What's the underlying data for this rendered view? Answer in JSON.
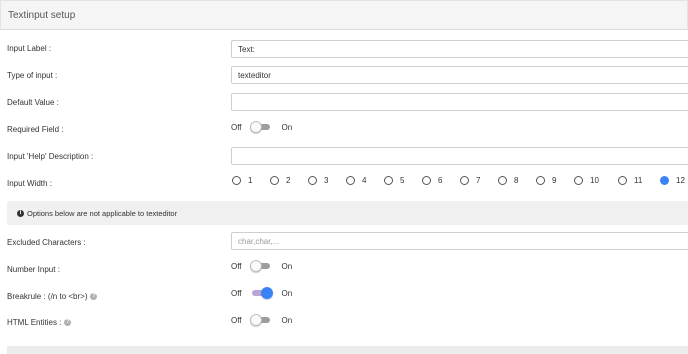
{
  "header": {
    "title": "Textinput setup"
  },
  "fields": {
    "input_label": {
      "label": "Input Label :",
      "value": "Text:"
    },
    "type_of_input": {
      "label": "Type of input :",
      "value": "texteditor"
    },
    "default_value": {
      "label": "Default Value :",
      "value": ""
    },
    "required_field": {
      "label": "Required Field :",
      "off": "Off",
      "on": "On",
      "state": "off"
    },
    "help_description": {
      "label": "Input 'Help' Description :",
      "value": ""
    },
    "input_width": {
      "label": "Input Width :",
      "options": [
        "1",
        "2",
        "3",
        "4",
        "5",
        "6",
        "7",
        "8",
        "9",
        "10",
        "11",
        "12"
      ],
      "selected": "12"
    },
    "excluded_characters": {
      "label": "Excluded Characters :",
      "placeholder": "char,char,..."
    },
    "number_input": {
      "label": "Number Input :",
      "off": "Off",
      "on": "On",
      "state": "off"
    },
    "breakrule": {
      "label": "Breakrule : (/n to <br>)",
      "off": "Off",
      "on": "On",
      "state": "on"
    },
    "html_entities": {
      "label": "HTML Entities :",
      "off": "Off",
      "on": "On",
      "state": "off"
    }
  },
  "notice": {
    "text": "Options below are not applicable to texteditor",
    "icon": "info-icon"
  },
  "colors": {
    "accent": "#3b82f6",
    "header_bg": "#f5f5f5",
    "notice_bg": "#f0f0f0"
  }
}
